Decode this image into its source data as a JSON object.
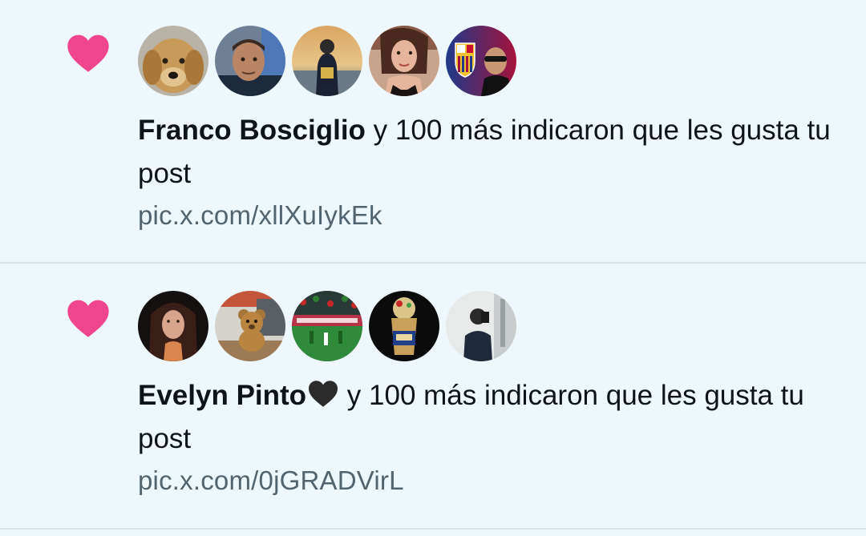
{
  "notifications": [
    {
      "type": "like",
      "first_user": "Franco Bosciglio",
      "rest_text": " y 100 más indicaron que les gusta tu post",
      "link": "pic.x.com/xllXuIykEk",
      "avatars": [
        "dog-avatar",
        "man-avatar",
        "sunset-avatar",
        "woman-avatar",
        "fc-barcelona-avatar"
      ]
    },
    {
      "type": "like",
      "first_user": "Evelyn Pinto",
      "first_user_emoji": "black-heart",
      "rest_text": " y 100 más indicaron que les gusta tu post",
      "link": "pic.x.com/0jGRADVirL",
      "avatars": [
        "woman-portrait-avatar",
        "teddy-bear-avatar",
        "stadium-avatar",
        "drink-avatar",
        "mirror-selfie-avatar"
      ]
    }
  ],
  "colors": {
    "background": "#eef8fc",
    "heart": "#f0468e",
    "text": "#0f1419",
    "link": "#536471",
    "divider": "#dbe3e8"
  }
}
